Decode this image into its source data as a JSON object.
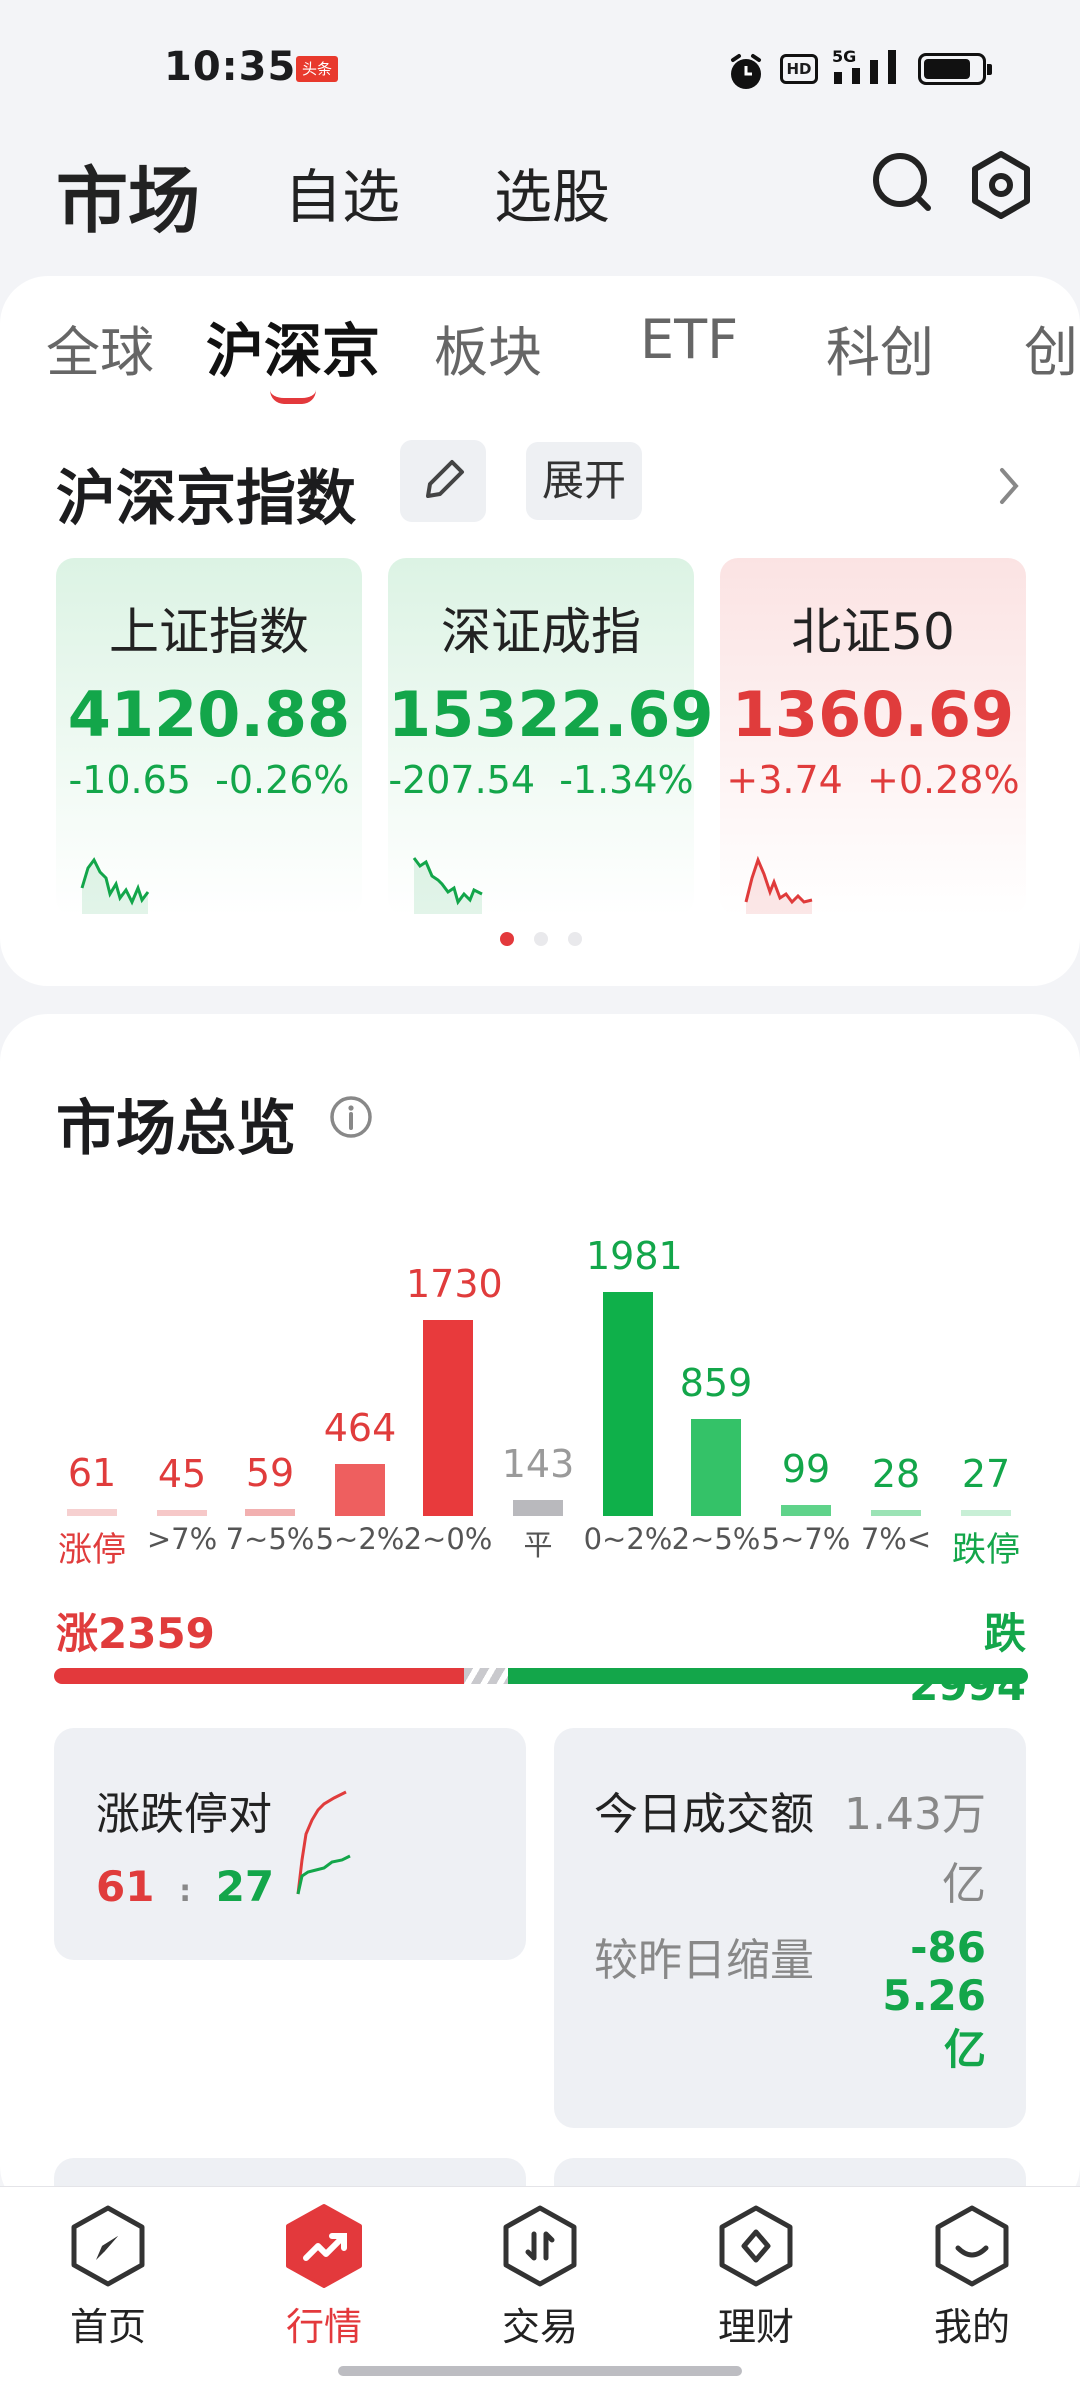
{
  "status_bar": {
    "time": "10:35",
    "badge": "头条",
    "hd": "HD",
    "network": "5G"
  },
  "header": {
    "tabs": [
      "市场",
      "自选",
      "选股"
    ],
    "active_tab": "市场"
  },
  "sub_tabs": {
    "items": [
      "全球",
      "沪深京",
      "板块",
      "ETF",
      "科创",
      "创"
    ],
    "active": "沪深京"
  },
  "index_section": {
    "title": "沪深京指数",
    "expand_label": "展开",
    "cards": [
      {
        "name": "上证指数",
        "value": "4120.88",
        "change": "-10.65",
        "pct": "-0.26%",
        "trend": "down"
      },
      {
        "name": "深证成指",
        "value": "15322.69",
        "change": "-207.54",
        "pct": "-1.34%",
        "trend": "down"
      },
      {
        "name": "北证50",
        "value": "1360.69",
        "change": "+3.74",
        "pct": "+0.28%",
        "trend": "up"
      }
    ],
    "page_dots": 3,
    "active_dot": 0
  },
  "overview": {
    "title": "市场总览",
    "distribution": [
      {
        "label": "涨停",
        "count": "61",
        "color": "#e03c3c"
      },
      {
        "label": ">7%",
        "count": "45",
        "color": "#e03c3c"
      },
      {
        "label": "7~5%",
        "count": "59",
        "color": "#e03c3c"
      },
      {
        "label": "5~2%",
        "count": "464",
        "color": "#e03c3c"
      },
      {
        "label": "2~0%",
        "count": "1730",
        "color": "#e03c3c"
      },
      {
        "label": "平",
        "count": "143",
        "color": "#9a9a9a"
      },
      {
        "label": "0~2%",
        "count": "1981",
        "color": "#13a64a"
      },
      {
        "label": "2~5%",
        "count": "859",
        "color": "#13a64a"
      },
      {
        "label": "5~7%",
        "count": "99",
        "color": "#13a64a"
      },
      {
        "label": "7%<",
        "count": "28",
        "color": "#13a64a"
      },
      {
        "label": "跌停",
        "count": "27",
        "color": "#13a64a"
      }
    ],
    "rise_label": "涨2359",
    "fall_label": "跌2994",
    "rise_count": 2359,
    "fall_count": 2994,
    "limit_card": {
      "title": "涨跌停对",
      "up": "61",
      "sep": ":",
      "down": "27"
    },
    "volume_card": {
      "title": "今日成交额",
      "amount_line1": "1.43万",
      "amount_line2": "亿",
      "compare_label": "较昨日缩量",
      "compare_line1": "-86",
      "compare_line2": "5.26",
      "compare_line3": "亿"
    }
  },
  "bottom_nav": {
    "items": [
      "首页",
      "行情",
      "交易",
      "理财",
      "我的"
    ],
    "active": "行情"
  },
  "colors": {
    "up": "#e03c3c",
    "down": "#13a64a",
    "accent": "#e3393c"
  }
}
